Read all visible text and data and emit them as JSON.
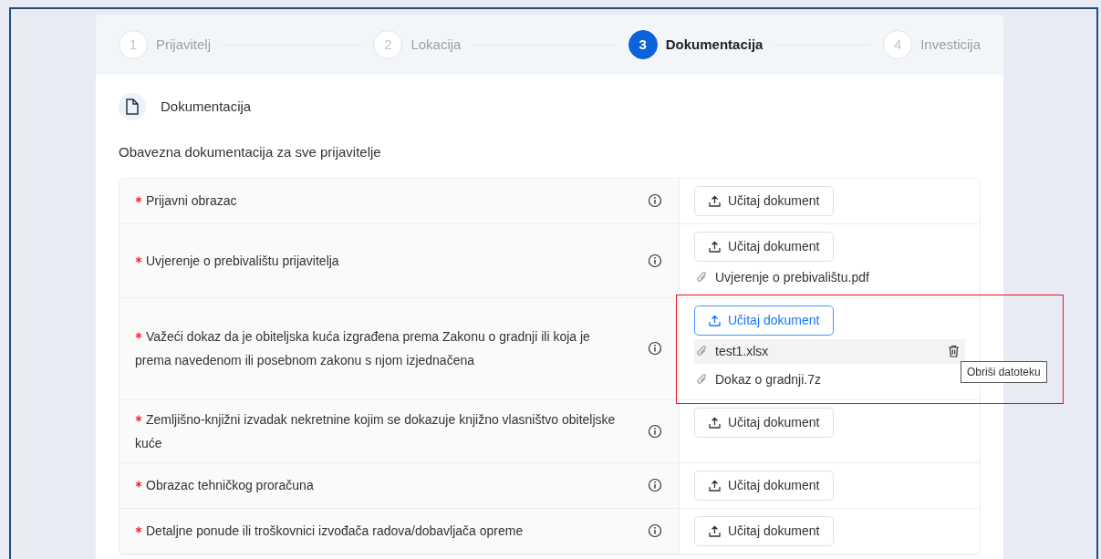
{
  "steps": [
    {
      "number": "1",
      "label": "Prijavitelj",
      "selected": false
    },
    {
      "number": "2",
      "label": "Lokacija",
      "selected": false
    },
    {
      "number": "3",
      "label": "Dokumentacija",
      "selected": true
    },
    {
      "number": "4",
      "label": "Investicija",
      "selected": false
    }
  ],
  "section": {
    "title": "Dokumentacija",
    "subtitle": "Obavezna dokumentacija za sve prijavitelje"
  },
  "documents": [
    {
      "required": true,
      "label": "Prijavni obrazac",
      "button": {
        "label": "Učitaj dokument",
        "focused": false
      },
      "highlighted": false
    },
    {
      "required": true,
      "label": "Uvjerenje o prebivalištu prijavitelja",
      "button": {
        "label": "Učitaj dokument",
        "focused": false
      },
      "highlighted": false,
      "files": [
        {
          "name": "Uvjerenje o prebivalištu.pdf",
          "hovered": false
        }
      ]
    },
    {
      "required": true,
      "label": "Važeći dokaz da je obiteljska kuća izgrađena prema Zakonu o gradnji ili koja je prema navedenom ili posebnom zakonu s njom izjednačena",
      "button": {
        "label": "Učitaj dokument",
        "focused": true
      },
      "highlighted": true,
      "files": [
        {
          "name": "test1.xlsx",
          "hovered": true
        },
        {
          "name": "Dokaz o gradnji.7z",
          "hovered": false
        }
      ]
    },
    {
      "required": true,
      "label": "Zemljišno-knjižni izvadak nekretnine kojim se dokazuje knjižno vlasništvo obiteljske kuće",
      "button": {
        "label": "Učitaj dokument",
        "focused": false
      },
      "highlighted": false
    },
    {
      "required": true,
      "label": "Obrazac tehničkog proračuna",
      "button": {
        "label": "Učitaj dokument",
        "focused": false
      },
      "highlighted": false
    },
    {
      "required": true,
      "label": "Detaljne ponude ili troškovnici izvođača radova/dobavljača opreme",
      "button": {
        "label": "Učitaj dokument",
        "focused": false
      },
      "highlighted": false
    }
  ],
  "tooltip": "Obriši datoteku"
}
